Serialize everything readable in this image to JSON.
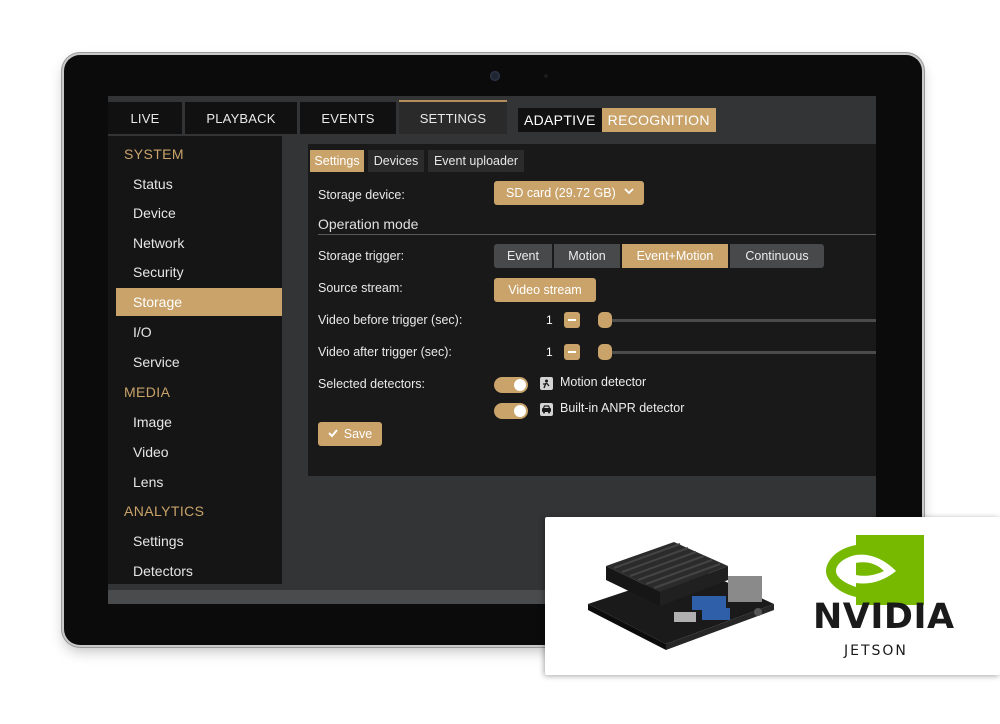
{
  "top_nav": {
    "tabs": [
      {
        "label": "LIVE"
      },
      {
        "label": "PLAYBACK"
      },
      {
        "label": "EVENTS"
      },
      {
        "label": "SETTINGS"
      }
    ],
    "active_tab": "SETTINGS",
    "brand": {
      "part1": "ADAPTIVE",
      "part2": "RECOGNITION"
    }
  },
  "sidebar": {
    "sections": [
      {
        "title": "SYSTEM",
        "items": [
          "Status",
          "Device",
          "Network",
          "Security",
          "Storage",
          "I/O",
          "Service"
        ]
      },
      {
        "title": "MEDIA",
        "items": [
          "Image",
          "Video",
          "Lens"
        ]
      },
      {
        "title": "ANALYTICS",
        "items": [
          "Settings",
          "Detectors"
        ]
      }
    ],
    "active_item": "Storage"
  },
  "subtabs": [
    "Settings",
    "Devices",
    "Event uploader"
  ],
  "active_subtab": "Settings",
  "form": {
    "storage_device_label": "Storage device:",
    "storage_device_value": "SD card (29.72 GB)",
    "operation_mode_title": "Operation mode",
    "storage_trigger_label": "Storage trigger:",
    "storage_trigger_options": [
      "Event",
      "Motion",
      "Event+Motion",
      "Continuous"
    ],
    "storage_trigger_selected": "Event+Motion",
    "source_stream_label": "Source stream:",
    "source_stream_value": "Video stream",
    "video_before_label": "Video before trigger (sec):",
    "video_before_value": "1",
    "video_after_label": "Video after trigger (sec):",
    "video_after_value": "1",
    "selected_detectors_label": "Selected detectors:",
    "detectors": [
      {
        "label": "Motion detector",
        "enabled": true
      },
      {
        "label": "Built-in ANPR detector",
        "enabled": true
      }
    ],
    "save_label": "Save"
  },
  "partner": {
    "name": "NVIDIA",
    "product": "JETSON"
  },
  "colors": {
    "accent": "#c9a36a",
    "panel": "#19191a",
    "sidebar": "#151516",
    "nvidia_green": "#76b900"
  }
}
